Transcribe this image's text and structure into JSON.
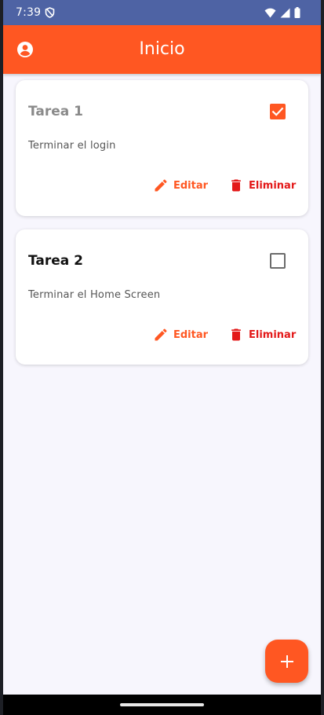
{
  "status_bar": {
    "time": "7:39",
    "shield_icon": "shield-icon",
    "wifi_icon": "wifi-icon",
    "signal_icon": "signal-icon",
    "battery_icon": "battery-icon"
  },
  "app_bar": {
    "title": "Inicio",
    "account_icon": "account-circle-icon",
    "color": "#ff5722"
  },
  "tasks": [
    {
      "title": "Tarea 1",
      "description": "Terminar el login",
      "completed": true,
      "edit_label": "Editar",
      "delete_label": "Eliminar"
    },
    {
      "title": "Tarea 2",
      "description": "Terminar el Home Screen",
      "completed": false,
      "edit_label": "Editar",
      "delete_label": "Eliminar"
    }
  ],
  "fab": {
    "icon": "plus-icon"
  },
  "colors": {
    "accent": "#ff5722",
    "delete": "#e31919",
    "status_bar": "#4e63a4",
    "background": "#f7f6fd"
  }
}
